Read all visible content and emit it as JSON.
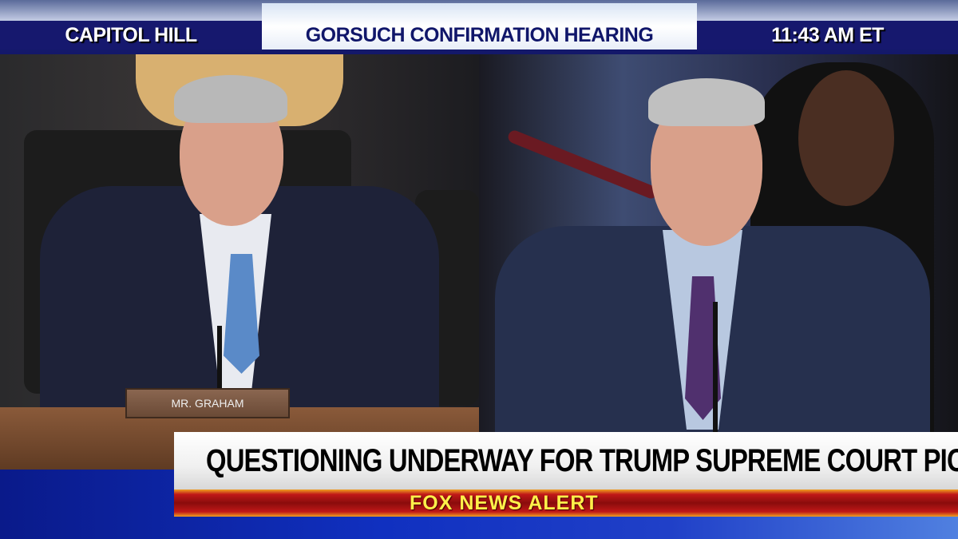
{
  "banner": {
    "location": "CAPITOL HILL",
    "topic": "GORSUCH CONFIRMATION HEARING",
    "time": "11:43 AM ET"
  },
  "scene": {
    "nameplate": "MR. GRAHAM"
  },
  "lower_third": {
    "headline": "QUESTIONING UNDERWAY FOR TRUMP SUPREME COURT PICK",
    "alert": "FOX NEWS ALERT"
  },
  "colors": {
    "banner_navy": "#16186e",
    "alert_red": "#c01818",
    "alert_text": "#fff04a"
  }
}
